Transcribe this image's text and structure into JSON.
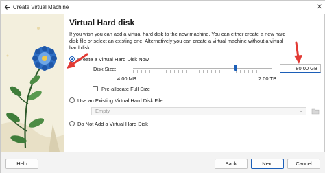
{
  "window": {
    "title": "Create Virtual Machine"
  },
  "page": {
    "heading": "Virtual Hard disk",
    "intro": "If you wish you can add a virtual hard disk to the new machine. You can either create a new hard disk file or select an existing one. Alternatively you can create a virtual machine without a virtual hard disk."
  },
  "options": {
    "create_new": "Create a Virtual Hard Disk Now",
    "use_existing": "Use an Existing Virtual Hard Disk File",
    "no_disk": "Do Not Add a Virtual Hard Disk",
    "selected": "create_new"
  },
  "disk_size": {
    "label": "Disk Size:",
    "value": "80.00 GB",
    "min_label": "4.00 MB",
    "max_label": "2.00 TB",
    "slider_fraction": 0.74
  },
  "preallocate": {
    "label": "Pre-allocate Full Size",
    "checked": false
  },
  "existing_file": {
    "selected": "Empty"
  },
  "footer": {
    "help": "Help",
    "back": "Back",
    "next": "Next",
    "cancel": "Cancel"
  },
  "icons": [
    "back-arrow-icon",
    "close-icon",
    "folder-icon",
    "chevron-down-icon"
  ],
  "colors": {
    "accent": "#1c5fb8",
    "annotation_arrow": "#e23a34",
    "art_background": "#f3efdd"
  }
}
